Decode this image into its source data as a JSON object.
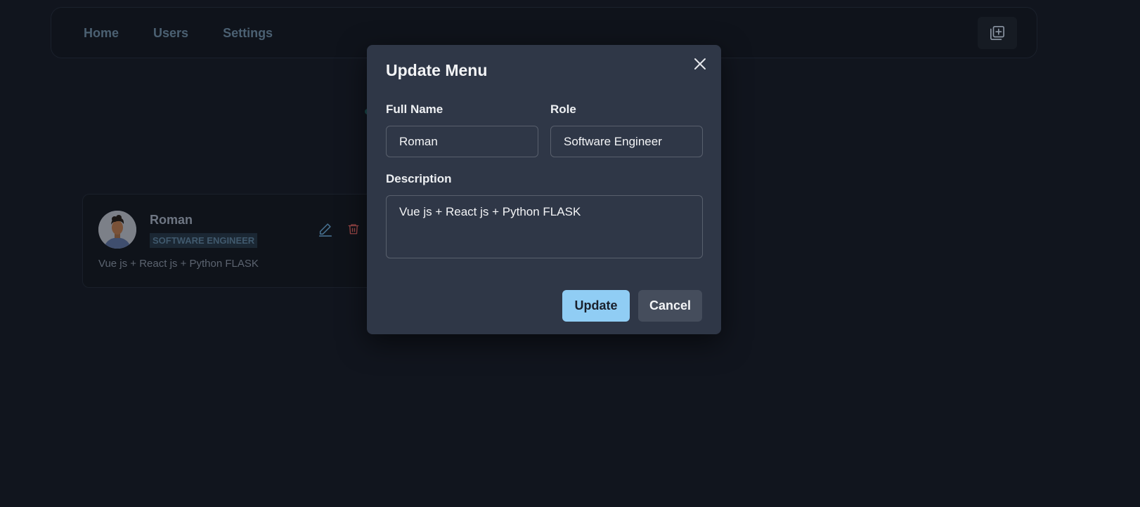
{
  "nav": {
    "links": [
      "Home",
      "Users",
      "Settings"
    ],
    "theme_icon": "sun-icon",
    "add_icon": "add-square-icon"
  },
  "card": {
    "name": "Roman",
    "role": "SOFTWARE ENGINEER",
    "description": "Vue js + React js + Python FLASK",
    "edit_icon": "pencil-icon",
    "delete_icon": "trash-icon"
  },
  "modal": {
    "title": "Update Menu",
    "close_icon": "close-icon",
    "full_name_label": "Full Name",
    "full_name_value": "Roman",
    "role_label": "Role",
    "role_value": "Software Engineer",
    "description_label": "Description",
    "description_value": "Vue js + React js + Python FLASK",
    "update_label": "Update",
    "cancel_label": "Cancel"
  },
  "colors": {
    "background": "#11151e",
    "modal": "#2f3747",
    "accent": "#90cdf4",
    "sun": "#d69e2e",
    "delete": "#c05454"
  }
}
